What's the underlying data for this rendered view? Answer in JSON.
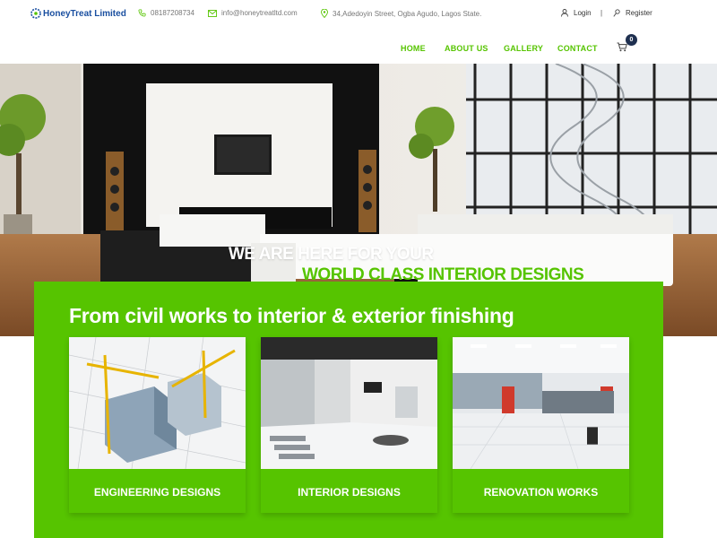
{
  "header": {
    "brand": "HoneyTreat Limited",
    "phone": "08187208734",
    "email": "info@honeytreatltd.com",
    "address": "34,Adedoyin Street, Ogba Agudo, Lagos State.",
    "login_label": "Login",
    "separator": "|",
    "register_label": "Register"
  },
  "nav": {
    "items": [
      {
        "label": "HOME"
      },
      {
        "label": "ABOUT US"
      },
      {
        "label": "GALLERY"
      },
      {
        "label": "CONTACT"
      }
    ],
    "cart_count": "0"
  },
  "hero": {
    "line1": "WE ARE HERE FOR YOUR",
    "line2": "WORLD CLASS INTERIOR DESIGNS"
  },
  "services": {
    "title": "From civil works to interior & exterior finishing",
    "cards": [
      {
        "label": "ENGINEERING DESIGNS",
        "image": "engineering-image"
      },
      {
        "label": "INTERIOR DESIGNS",
        "image": "interior-image"
      },
      {
        "label": "RENOVATION WORKS",
        "image": "renovation-image"
      }
    ]
  },
  "colors": {
    "accent": "#56c400",
    "brand_blue": "#1a4fa0",
    "badge": "#1f3050"
  },
  "icons": [
    "logo-icon",
    "phone-icon",
    "mail-icon",
    "location-icon",
    "user-icon",
    "key-icon",
    "cart-icon"
  ]
}
